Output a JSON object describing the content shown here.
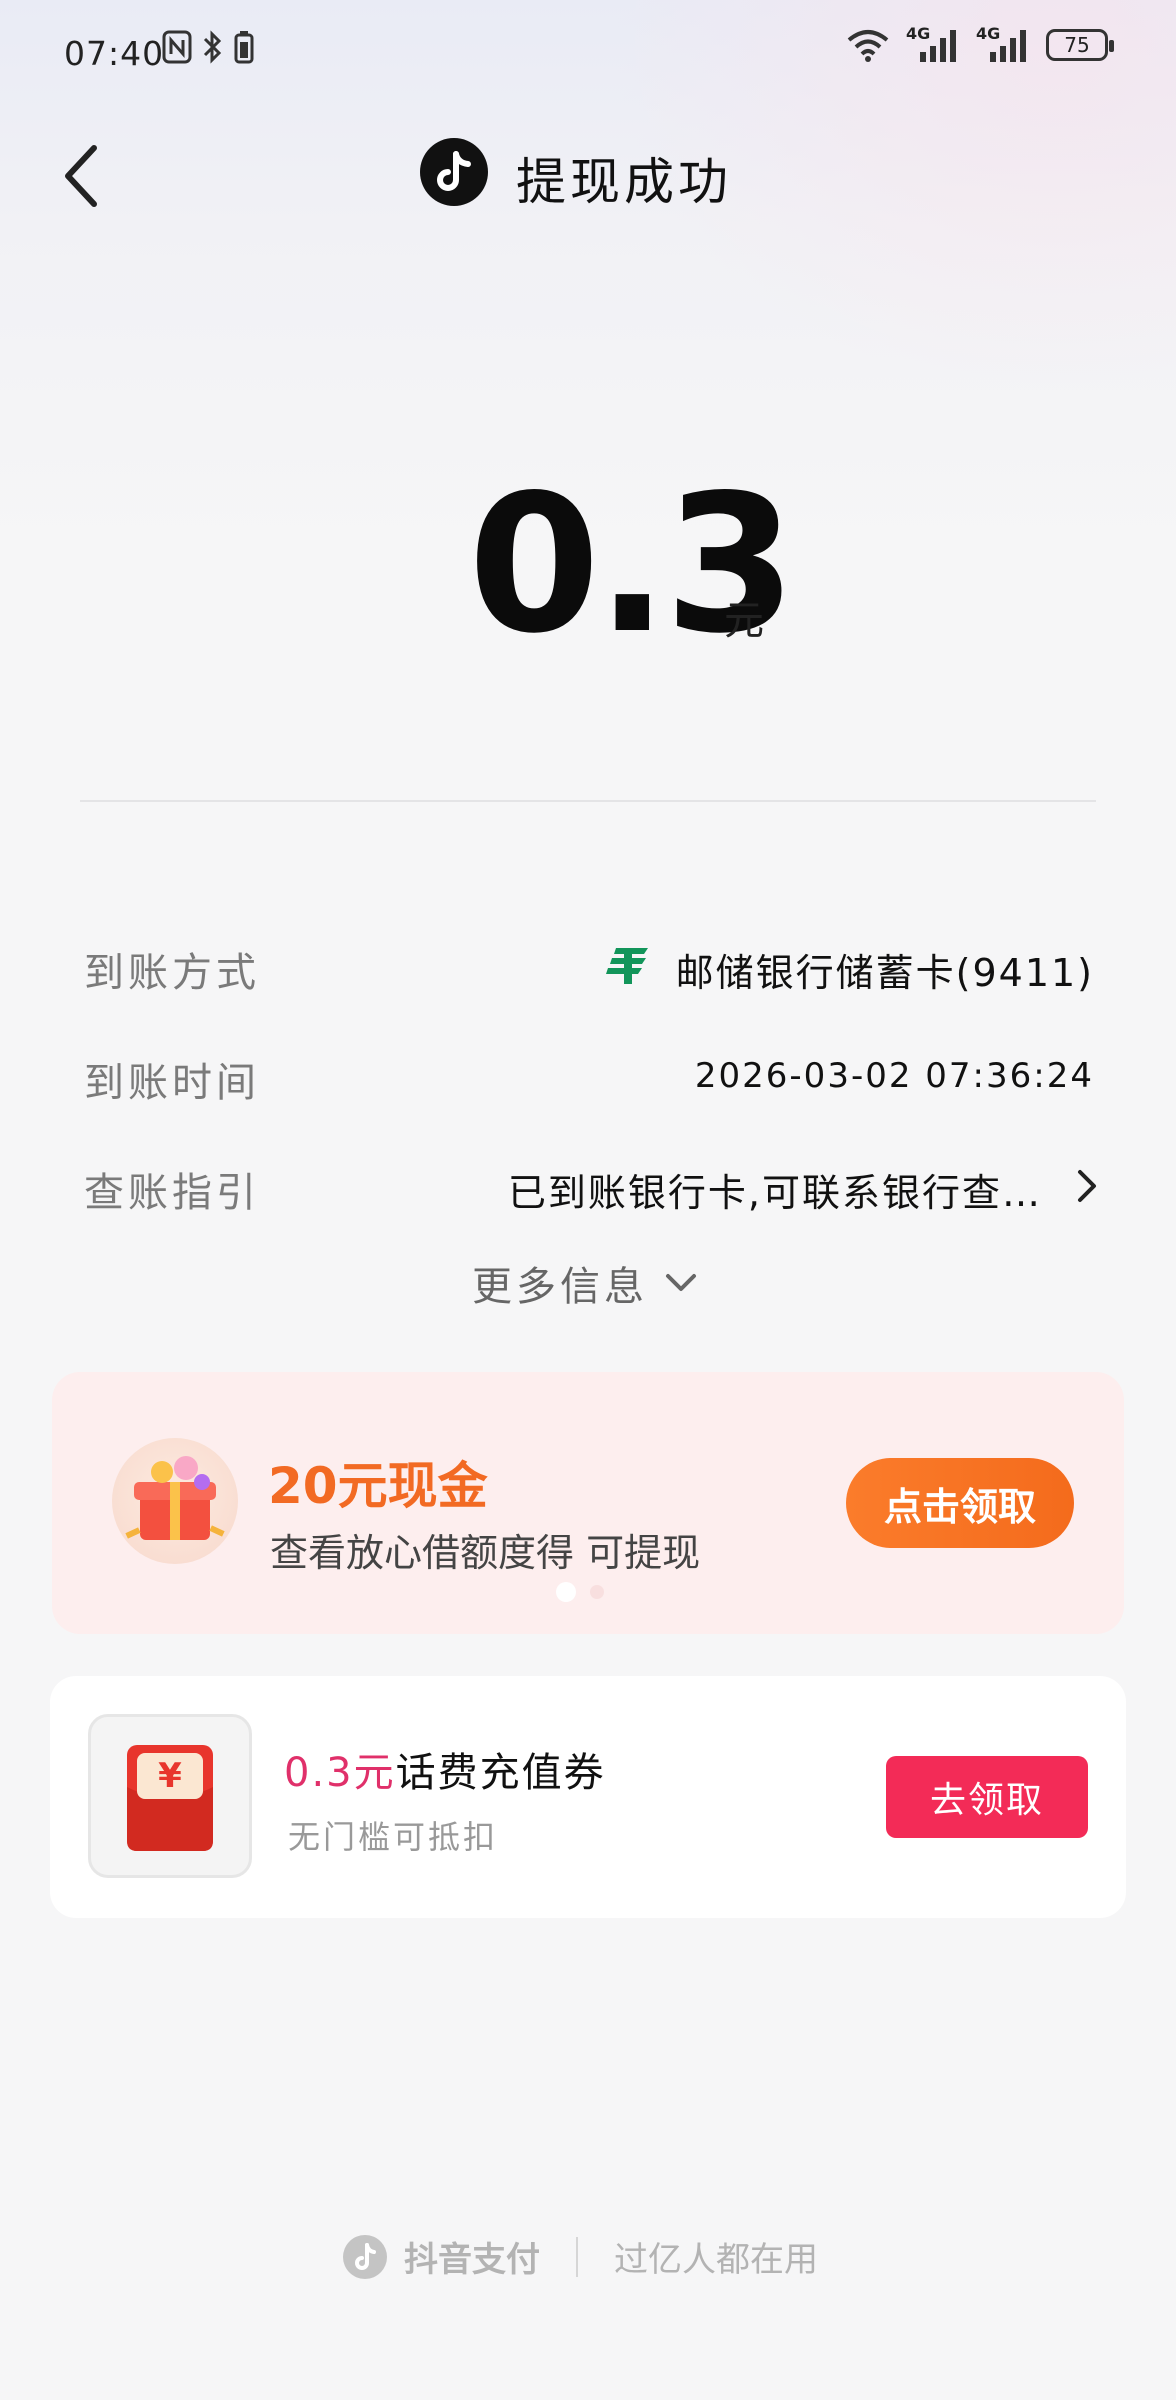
{
  "status_bar": {
    "time": "07:40",
    "battery": "75",
    "network": [
      "4G",
      "4G"
    ]
  },
  "header": {
    "title": "提现成功",
    "logo_icon": "tiktok-logo-icon"
  },
  "amount": {
    "value": "0.3",
    "unit": "元"
  },
  "details": {
    "method_label": "到账方式",
    "method_value": "邮储银行储蓄卡(9411)",
    "time_label": "到账时间",
    "time_value": "2026-03-02 07:36:24",
    "guide_label": "查账指引",
    "guide_value": "已到账银行卡,可联系银行查…",
    "more_label": "更多信息"
  },
  "promo": {
    "title": "20元现金",
    "subtitle": "查看放心借额度得 可提现",
    "button": "点击领取",
    "accent": "#f26a23"
  },
  "coupon": {
    "amount": "0.3元",
    "title_rest": "话费充值券",
    "subtitle": "无门槛可抵扣",
    "button": "去领取",
    "accent": "#f32b57"
  },
  "footer": {
    "brand": "抖音支付",
    "slogan": "过亿人都在用"
  }
}
